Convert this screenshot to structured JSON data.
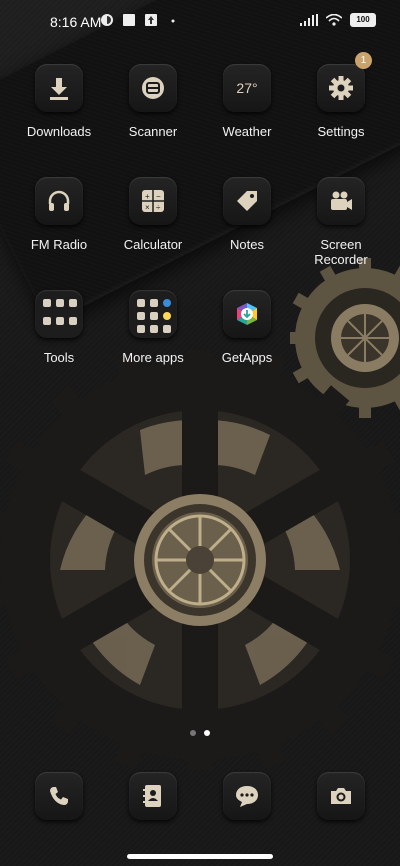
{
  "status": {
    "time": "8:16 AM",
    "battery": "100",
    "icons_left": [
      "calendar-icon",
      "photo-icon",
      "upload-icon",
      "dot"
    ],
    "icons_right": [
      "signal-icon",
      "wifi-icon",
      "battery-icon"
    ]
  },
  "apps": {
    "row1": [
      {
        "label": "Downloads",
        "icon": "download-icon"
      },
      {
        "label": "Scanner",
        "icon": "scanner-icon"
      },
      {
        "label": "Weather",
        "icon": "weather-icon",
        "text": "27°"
      },
      {
        "label": "Settings",
        "icon": "gear-icon",
        "badge": "1"
      }
    ],
    "row2": [
      {
        "label": "FM Radio",
        "icon": "headphones-icon"
      },
      {
        "label": "Calculator",
        "icon": "calculator-icon"
      },
      {
        "label": "Notes",
        "icon": "tag-icon"
      },
      {
        "label": "Screen\nRecorder",
        "label_line1": "Screen",
        "label_line2": "Recorder",
        "icon": "video-camera-icon"
      }
    ],
    "row3": [
      {
        "label": "Tools",
        "icon": "folder-icon"
      },
      {
        "label": "More apps",
        "icon": "folder-icon"
      },
      {
        "label": "GetApps",
        "icon": "getapps-icon"
      }
    ]
  },
  "dock": [
    "phone-icon",
    "contacts-icon",
    "messages-icon",
    "camera-icon"
  ],
  "page_indicator": {
    "pages": 2,
    "current": 2
  }
}
